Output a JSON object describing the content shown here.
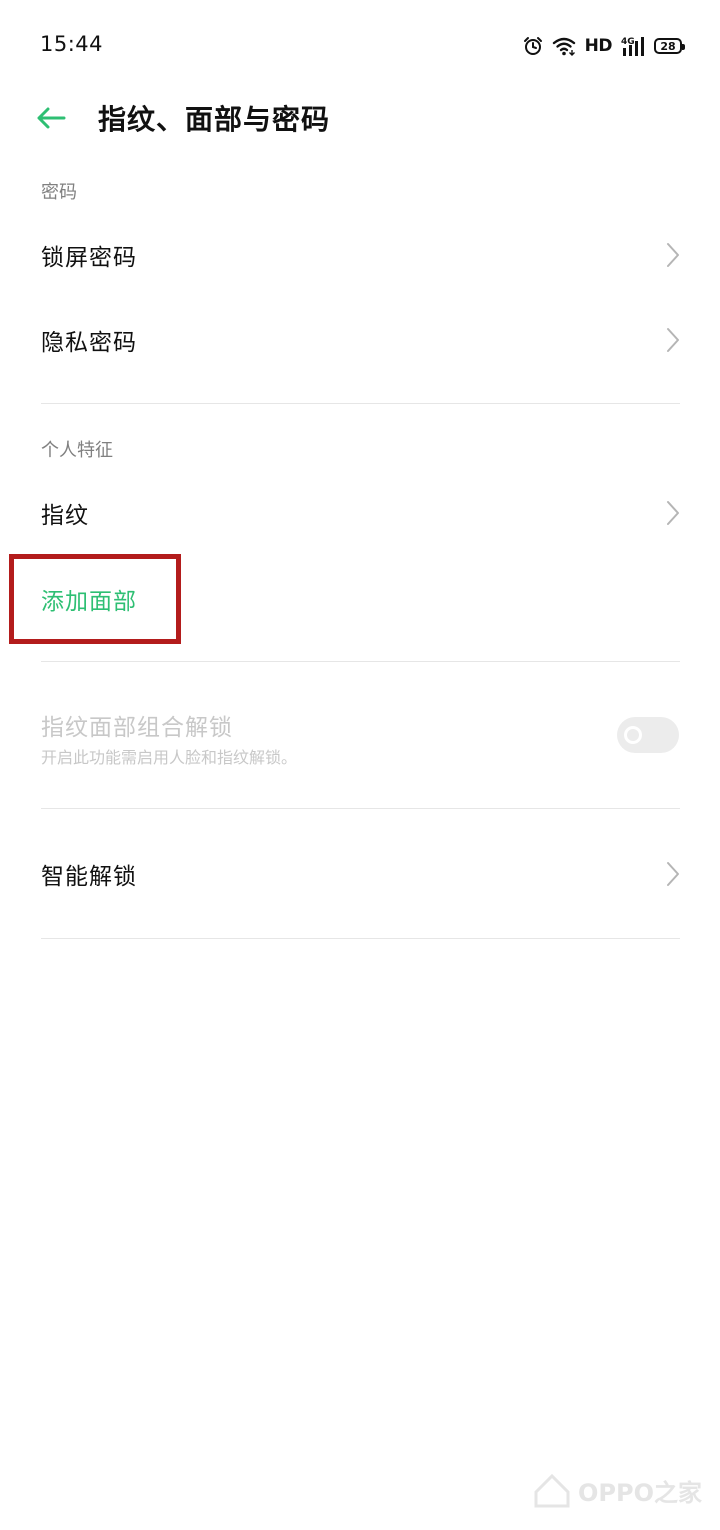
{
  "status_bar": {
    "time": "15:44",
    "network_label": "HD",
    "signal_label": "4G",
    "battery_level": "28"
  },
  "header": {
    "title": "指纹、面部与密码"
  },
  "sections": {
    "password": {
      "label": "密码",
      "items": [
        {
          "label": "锁屏密码"
        },
        {
          "label": "隐私密码"
        }
      ]
    },
    "biometrics": {
      "label": "个人特征",
      "items": [
        {
          "label": "指纹"
        },
        {
          "label": "添加面部"
        }
      ]
    },
    "combo_unlock": {
      "title": "指纹面部组合解锁",
      "description": "开启此功能需启用人脸和指纹解锁。",
      "enabled": false
    },
    "smart_unlock": {
      "label": "智能解锁"
    }
  },
  "colors": {
    "accent": "#2ebf73",
    "highlight_border": "#b31c1c",
    "disabled_text": "#c8c8c8"
  },
  "watermark": {
    "text": "OPPO之家"
  }
}
